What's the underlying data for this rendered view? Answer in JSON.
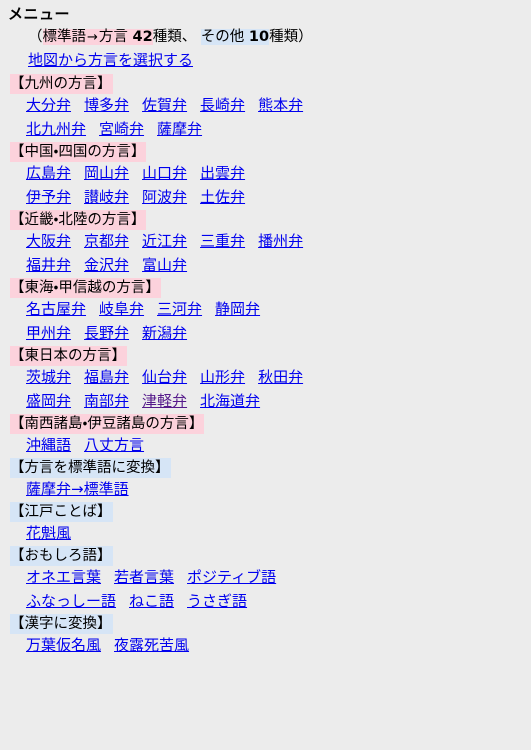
{
  "page": {
    "title": "メニュー",
    "background_color": "#ececec",
    "link_color": "#0000ee",
    "visited_link_color": "#551a8b",
    "pink_highlight_color": "#fcd2dc",
    "blue_highlight_color": "#d6e5f6"
  },
  "subtitle": {
    "open_paren": "（",
    "standard_label": "標準語",
    "arrow": "→",
    "dialect_label": "方言",
    "dialect_count": "42",
    "dialect_unit": "種類",
    "separator": "、",
    "other_label": "その他",
    "other_count": "10",
    "other_unit": "種類",
    "close_paren": "）"
  },
  "map_link": {
    "label": "地図から方言を選択する"
  },
  "sections": [
    {
      "header": "【九州の方言】",
      "style": "pink",
      "rows": [
        [
          {
            "label": "大分弁",
            "visited": false
          },
          {
            "label": "博多弁",
            "visited": false
          },
          {
            "label": "佐賀弁",
            "visited": false
          },
          {
            "label": "長崎弁",
            "visited": false
          },
          {
            "label": "熊本弁",
            "visited": false
          }
        ],
        [
          {
            "label": "北九州弁",
            "visited": false
          },
          {
            "label": "宮崎弁",
            "visited": false
          },
          {
            "label": "薩摩弁",
            "visited": false
          }
        ]
      ]
    },
    {
      "header": "【中国・四国の方言】",
      "style": "pink",
      "rows": [
        [
          {
            "label": "広島弁",
            "visited": false
          },
          {
            "label": "岡山弁",
            "visited": false
          },
          {
            "label": "山口弁",
            "visited": false
          },
          {
            "label": "出雲弁",
            "visited": false
          }
        ],
        [
          {
            "label": "伊予弁",
            "visited": false
          },
          {
            "label": "讃岐弁",
            "visited": false
          },
          {
            "label": "阿波弁",
            "visited": false
          },
          {
            "label": "土佐弁",
            "visited": false
          }
        ]
      ]
    },
    {
      "header": "【近畿・北陸の方言】",
      "style": "pink",
      "rows": [
        [
          {
            "label": "大阪弁",
            "visited": false
          },
          {
            "label": "京都弁",
            "visited": false
          },
          {
            "label": "近江弁",
            "visited": false
          },
          {
            "label": "三重弁",
            "visited": false
          },
          {
            "label": "播州弁",
            "visited": false
          }
        ],
        [
          {
            "label": "福井弁",
            "visited": false
          },
          {
            "label": "金沢弁",
            "visited": false
          },
          {
            "label": "富山弁",
            "visited": false
          }
        ]
      ]
    },
    {
      "header": "【東海・甲信越の方言】",
      "style": "pink",
      "rows": [
        [
          {
            "label": "名古屋弁",
            "visited": false
          },
          {
            "label": "岐阜弁",
            "visited": false
          },
          {
            "label": "三河弁",
            "visited": false
          },
          {
            "label": "静岡弁",
            "visited": false
          }
        ],
        [
          {
            "label": "甲州弁",
            "visited": false
          },
          {
            "label": "長野弁",
            "visited": false
          },
          {
            "label": "新潟弁",
            "visited": false
          }
        ]
      ]
    },
    {
      "header": "【東日本の方言】",
      "style": "pink",
      "rows": [
        [
          {
            "label": "茨城弁",
            "visited": false
          },
          {
            "label": "福島弁",
            "visited": false
          },
          {
            "label": "仙台弁",
            "visited": false
          },
          {
            "label": "山形弁",
            "visited": false
          },
          {
            "label": "秋田弁",
            "visited": false
          }
        ],
        [
          {
            "label": "盛岡弁",
            "visited": false
          },
          {
            "label": "南部弁",
            "visited": false
          },
          {
            "label": "津軽弁",
            "visited": true
          },
          {
            "label": "北海道弁",
            "visited": false
          }
        ]
      ]
    },
    {
      "header": "【南西諸島・伊豆諸島の方言】",
      "style": "pink",
      "rows": [
        [
          {
            "label": "沖縄語",
            "visited": false
          },
          {
            "label": "八丈方言",
            "visited": false
          }
        ]
      ]
    },
    {
      "header": "【方言を標準語に変換】",
      "style": "blue",
      "rows": [
        [
          {
            "label": "薩摩弁→標準語",
            "visited": false
          }
        ]
      ]
    },
    {
      "header": "【江戸ことば】",
      "style": "blue",
      "rows": [
        [
          {
            "label": "花魁風",
            "visited": false
          }
        ]
      ]
    },
    {
      "header": "【おもしろ語】",
      "style": "blue",
      "rows": [
        [
          {
            "label": "オネエ言葉",
            "visited": false
          },
          {
            "label": "若者言葉",
            "visited": false
          },
          {
            "label": "ポジティブ語",
            "visited": false
          }
        ],
        [
          {
            "label": "ふなっしー語",
            "visited": false
          },
          {
            "label": "ねこ語",
            "visited": false
          },
          {
            "label": "うさぎ語",
            "visited": false
          }
        ]
      ]
    },
    {
      "header": "【漢字に変換】",
      "style": "blue",
      "rows": [
        [
          {
            "label": "万葉仮名風",
            "visited": false
          },
          {
            "label": "夜露死苦風",
            "visited": false
          }
        ]
      ]
    }
  ]
}
